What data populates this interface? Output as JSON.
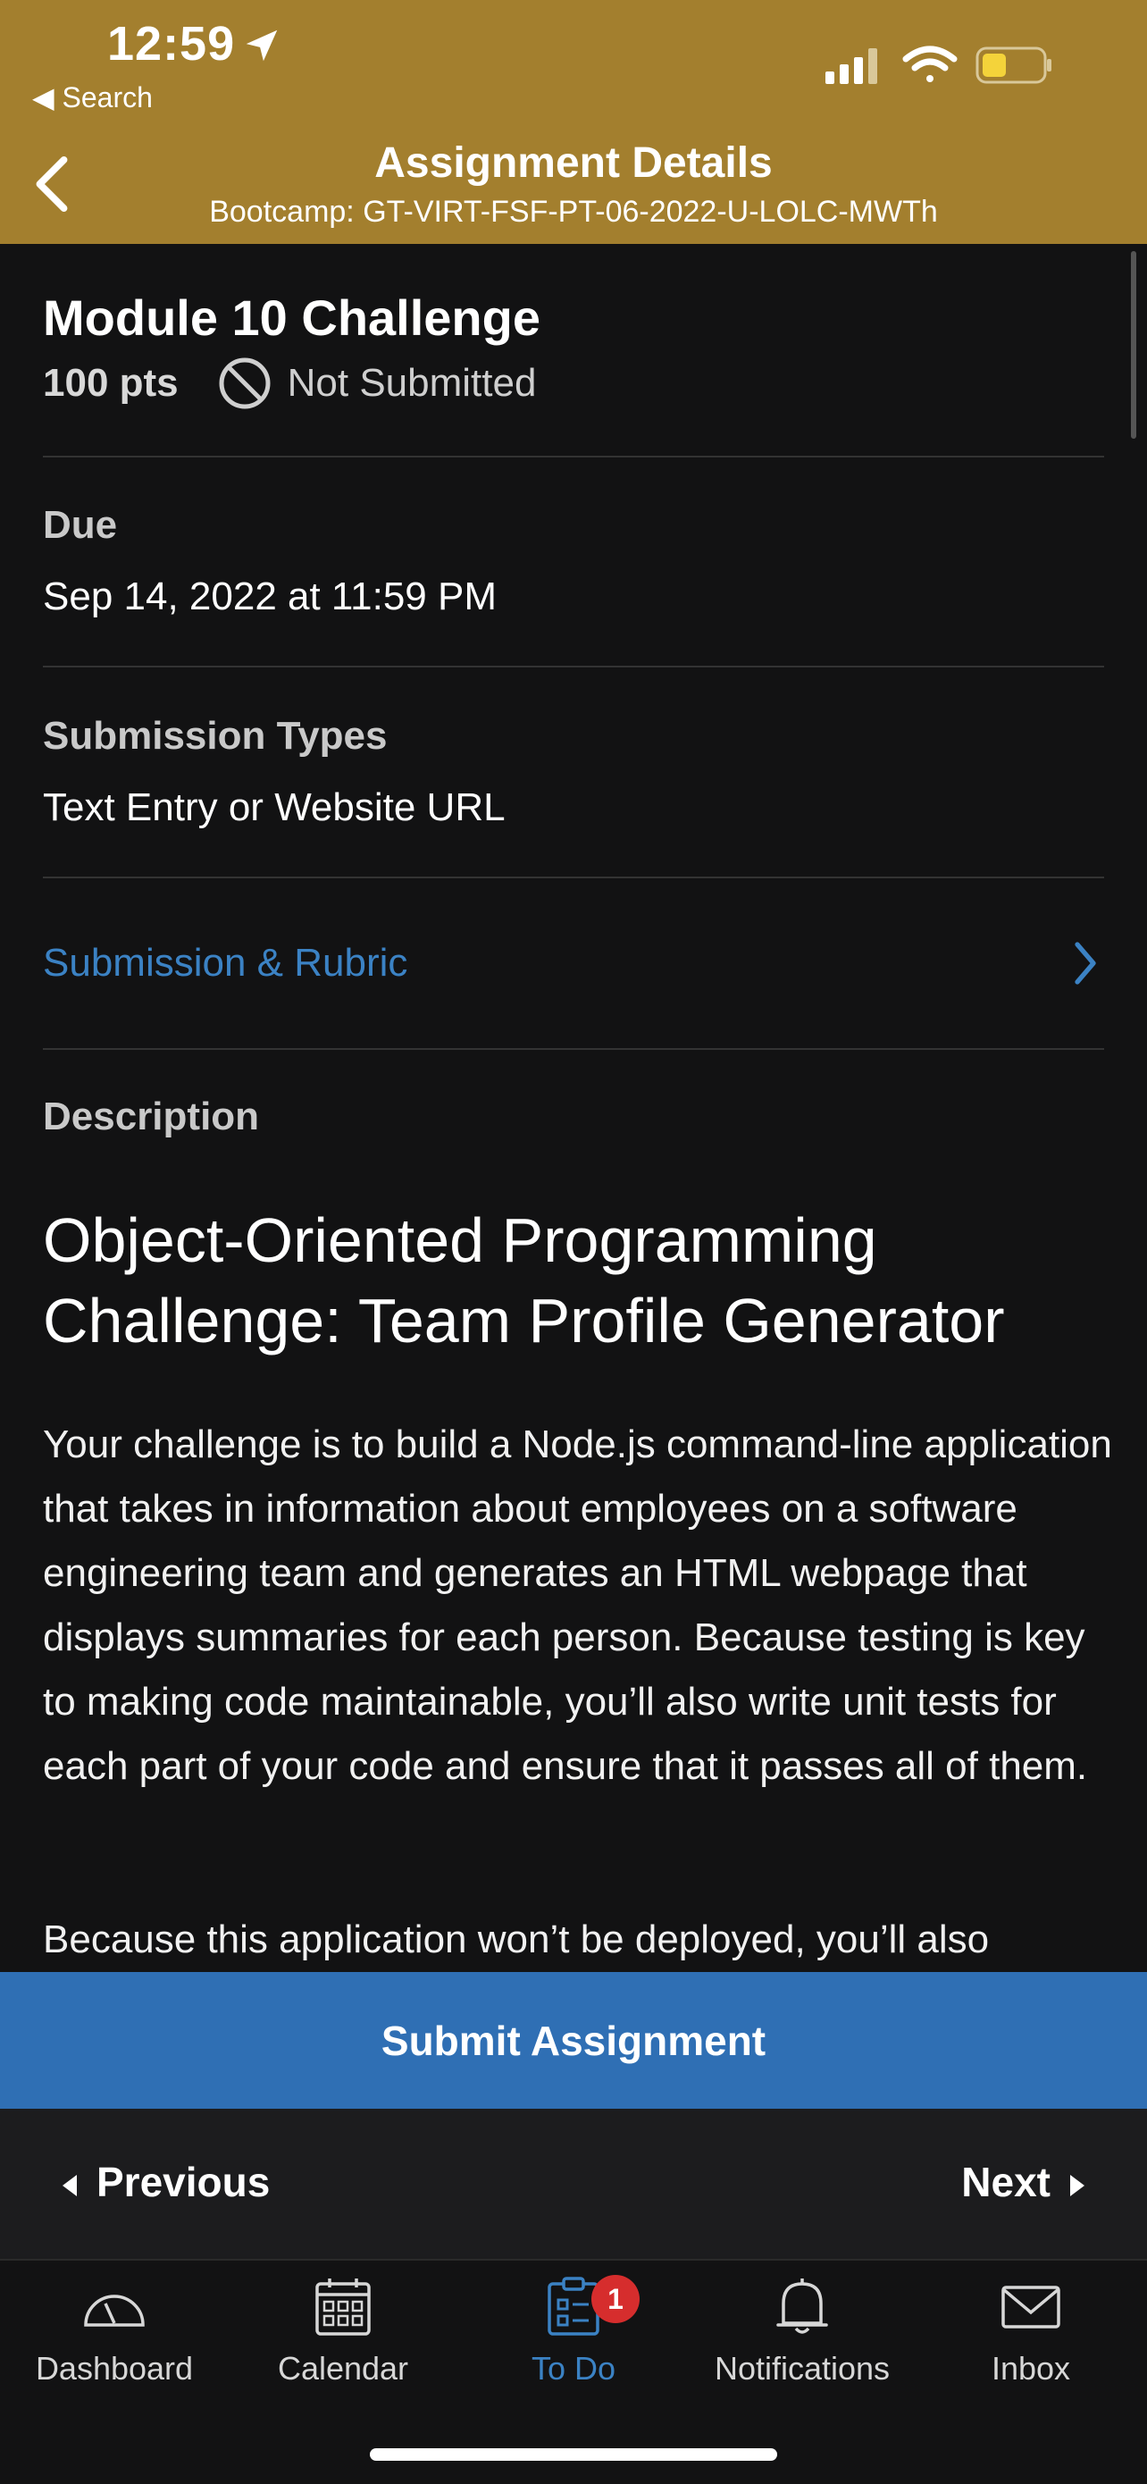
{
  "status": {
    "time": "12:59",
    "back_app": "◀ Search"
  },
  "header": {
    "title": "Assignment Details",
    "subtitle": "Bootcamp: GT-VIRT-FSF-PT-06-2022-U-LOLC-MWTh"
  },
  "assignment": {
    "title": "Module 10 Challenge",
    "points": "100 pts",
    "status": "Not Submitted",
    "due_label": "Due",
    "due_value": "Sep 14, 2022 at 11:59 PM",
    "types_label": "Submission Types",
    "types_value": "Text Entry or Website URL",
    "rubric_link": "Submission & Rubric",
    "description_label": "Description",
    "description_heading": "Object-Oriented Programming Challenge: Team Profile Generator",
    "description_p1": "Your challenge is to build a Node.js command-line application that takes in information about employees on a software engineering team and generates an HTML webpage that displays summaries for each person. Because testing is key to making code maintainable, you’ll also write unit tests for each part of your code and ensure that it passes all of them.",
    "description_p2": "Because this application won’t be deployed, you’ll also"
  },
  "actions": {
    "submit": "Submit Assignment",
    "previous": "Previous",
    "next": "Next"
  },
  "tabs": {
    "dashboard": "Dashboard",
    "calendar": "Calendar",
    "todo": "To Do",
    "todo_badge": "1",
    "notifications": "Notifications",
    "inbox": "Inbox"
  },
  "colors": {
    "header": "#a37f2e",
    "accent": "#3b82c4",
    "submit": "#2f6fb4",
    "background": "#121213",
    "badge": "#d62d2d"
  },
  "icons": [
    "location-arrow-icon",
    "signal-icon",
    "wifi-icon",
    "battery-icon",
    "back-chevron-icon",
    "not-submitted-icon",
    "chevron-right-icon",
    "dashboard-icon",
    "calendar-icon",
    "todo-icon",
    "bell-icon",
    "envelope-icon"
  ]
}
